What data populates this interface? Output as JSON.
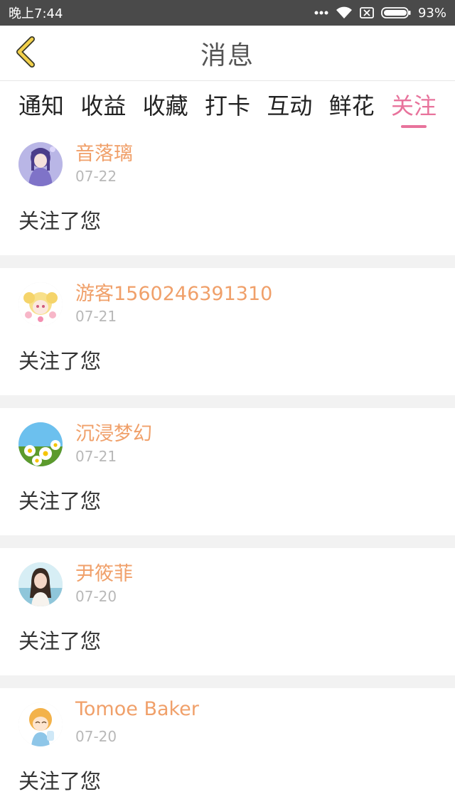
{
  "status_bar": {
    "time": "晚上7:44",
    "battery": "93%",
    "icons": [
      "more-dots-icon",
      "wifi-icon",
      "sim-x-icon",
      "battery-icon"
    ]
  },
  "header": {
    "title": "消息",
    "back_icon": "chevron-left-icon"
  },
  "tabs": [
    {
      "label": "通知"
    },
    {
      "label": "收益"
    },
    {
      "label": "收藏"
    },
    {
      "label": "打卡"
    },
    {
      "label": "互动"
    },
    {
      "label": "鲜花"
    },
    {
      "label": "关注",
      "active": true
    }
  ],
  "colors": {
    "accent": "#e8739c",
    "username": "#f0a06a",
    "date": "#b8b8b8",
    "back_chevron": "#f3d14b"
  },
  "messages": [
    {
      "name": "音落璃",
      "date": "07-22",
      "text": "关注了您",
      "avatar": "anime-girl-purple-avatar"
    },
    {
      "name": "游客1560246391310",
      "date": "07-21",
      "text": "关注了您",
      "avatar": "chibi-blonde-avatar"
    },
    {
      "name": "沉浸梦幻",
      "date": "07-21",
      "text": "关注了您",
      "avatar": "daisy-flowers-avatar"
    },
    {
      "name": "尹筱菲",
      "date": "07-20",
      "text": "关注了您",
      "avatar": "woman-photo-avatar"
    },
    {
      "name": "Tomoe Baker",
      "date": "07-20",
      "text": "关注了您",
      "avatar": "chibi-orange-hair-avatar"
    }
  ]
}
